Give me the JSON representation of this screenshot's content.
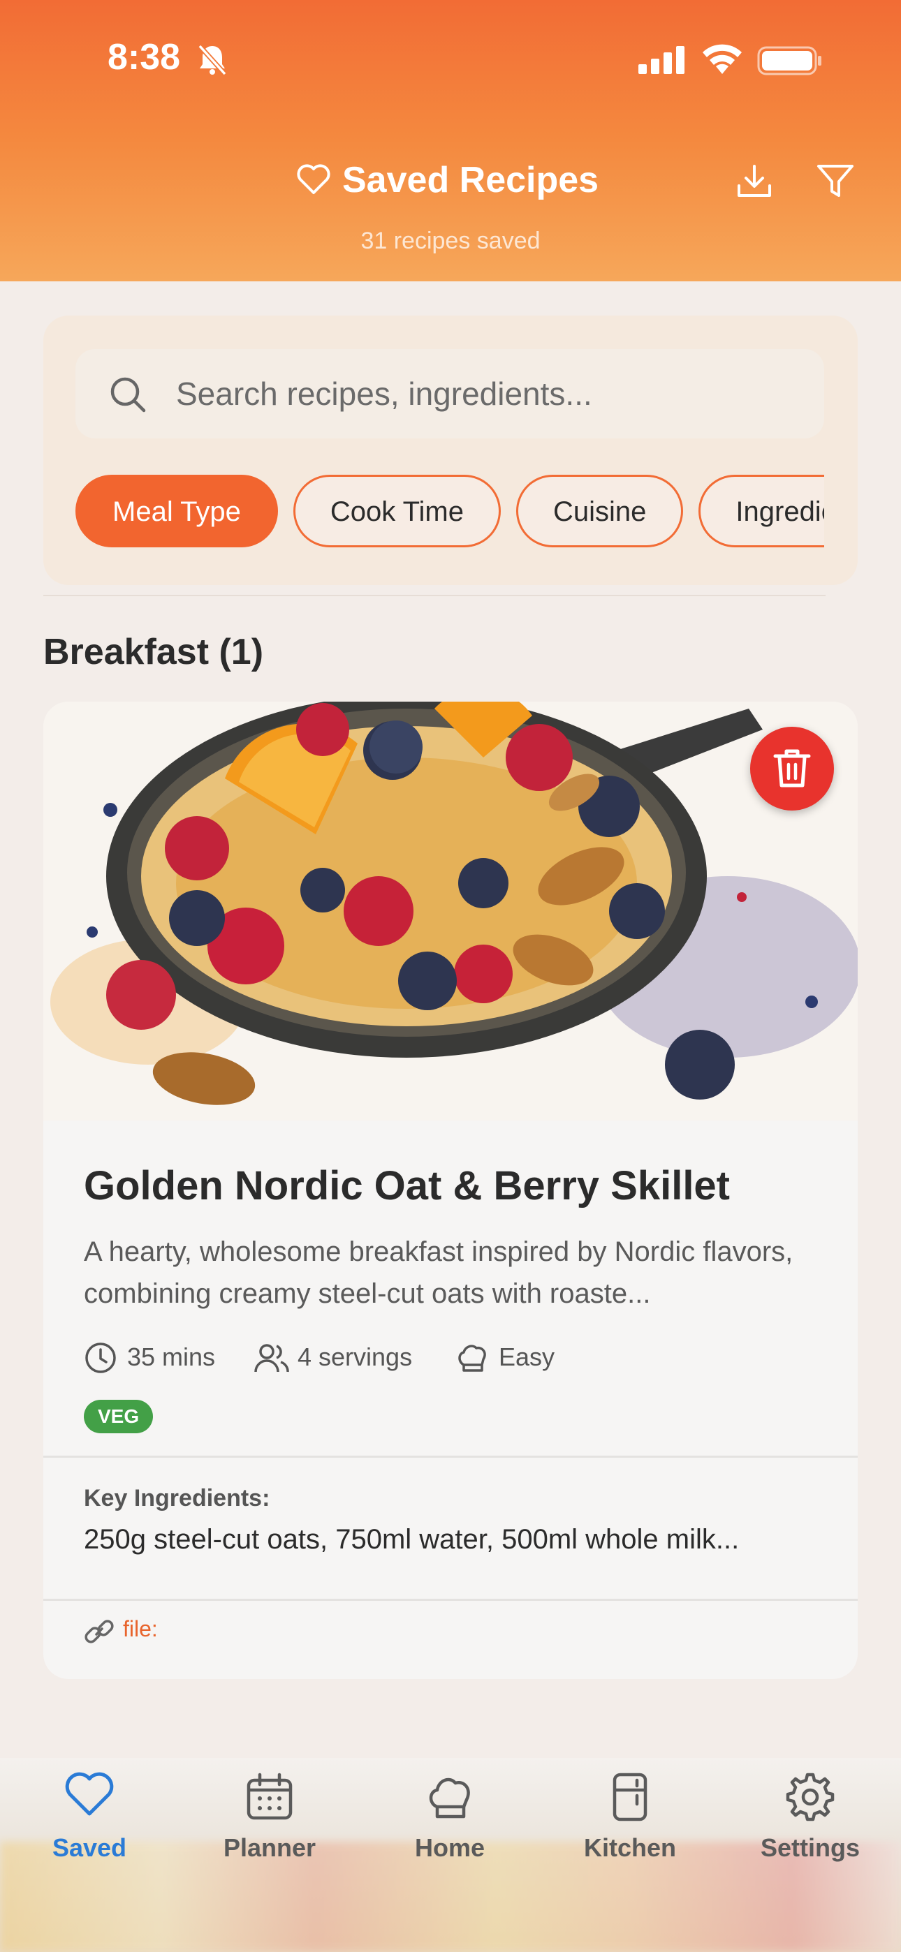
{
  "status_bar": {
    "time": "8:38"
  },
  "header": {
    "title": "Saved Recipes",
    "subtitle": "31 recipes saved"
  },
  "search": {
    "placeholder": "Search recipes, ingredients..."
  },
  "filters": {
    "chips": [
      "Meal Type",
      "Cook Time",
      "Cuisine",
      "Ingredients"
    ],
    "active": "Meal Type"
  },
  "section": {
    "title": "Breakfast (1)"
  },
  "recipe": {
    "title": "Golden Nordic Oat & Berry Skillet",
    "description": "A hearty, wholesome breakfast inspired by Nordic flavors, combining creamy steel-cut oats with roaste...",
    "time": "35 mins",
    "servings": "4 servings",
    "difficulty": "Easy",
    "badge": "VEG",
    "key_ingredients_label": "Key Ingredients:",
    "key_ingredients": "250g steel-cut oats, 750ml water, 500ml whole milk...",
    "source": "file:"
  },
  "tabs": [
    {
      "label": "Saved",
      "icon": "heart-icon",
      "active": true
    },
    {
      "label": "Planner",
      "icon": "calendar-icon",
      "active": false
    },
    {
      "label": "Home",
      "icon": "chef-hat-icon",
      "active": false
    },
    {
      "label": "Kitchen",
      "icon": "fridge-icon",
      "active": false
    },
    {
      "label": "Settings",
      "icon": "gear-icon",
      "active": false
    }
  ],
  "colors": {
    "accent": "#f2652f",
    "header_top": "#f26c35",
    "header_bottom": "#f6a75a",
    "tab_active": "#2a7bd6",
    "veg_badge": "#43a047",
    "delete": "#e8332d"
  }
}
